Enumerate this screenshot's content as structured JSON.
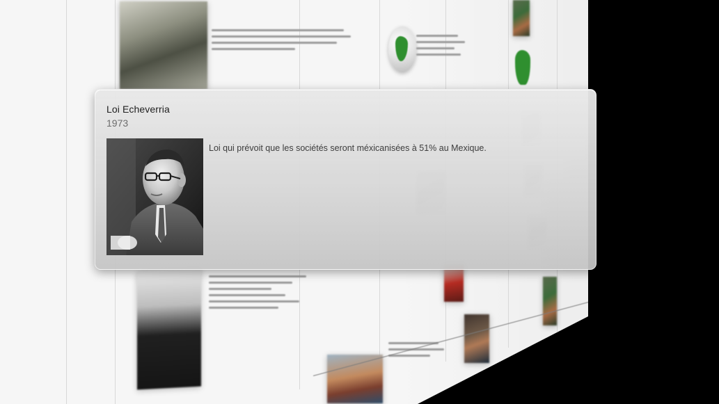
{
  "popup": {
    "title": "Loi Echeverria",
    "year": "1973",
    "description": "Loi qui prévoit que les sociétés seront méxicanisées à 51% au Mexique.",
    "photo_icon": "portrait-photo"
  },
  "background": {
    "colors": {
      "wall": "#f6f6f6",
      "outside": "#000000",
      "map_green": "#2f8f2f"
    },
    "icons": [
      "globe-icon",
      "map-icon"
    ]
  }
}
